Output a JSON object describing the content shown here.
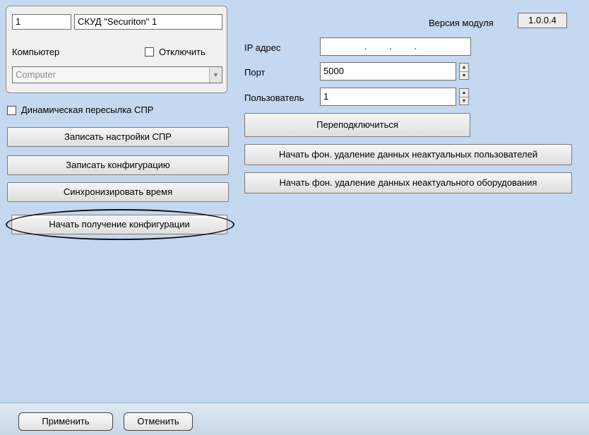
{
  "group": {
    "id": "1",
    "name": "СКУД \"Securiton\" 1",
    "computer_label": "Компьютер",
    "disable_label": "Отключить",
    "computer_value": "Computer"
  },
  "left": {
    "dynamic_label": "Динамическая пересылка СПР",
    "buttons": {
      "write_settings": "Записать настройки СПР",
      "write_config": "Записать конфигурацию",
      "sync_time": "Синхронизировать время",
      "start_get_config": "Начать получение конфигурации"
    }
  },
  "right": {
    "version_label": "Версия модуля",
    "version_value": "1.0.0.4",
    "ip_label": "IP адрес",
    "ip_value": ". . .",
    "port_label": "Порт",
    "port_value": "5000",
    "user_label": "Пользователь",
    "user_value": "1",
    "reconnect": "Переподключиться",
    "delete_users": "Начать фон. удаление данных неактуальных пользователей",
    "delete_equipment": "Начать фон. удаление данных неактуального оборудования"
  },
  "footer": {
    "apply": "Применить",
    "cancel": "Отменить"
  }
}
